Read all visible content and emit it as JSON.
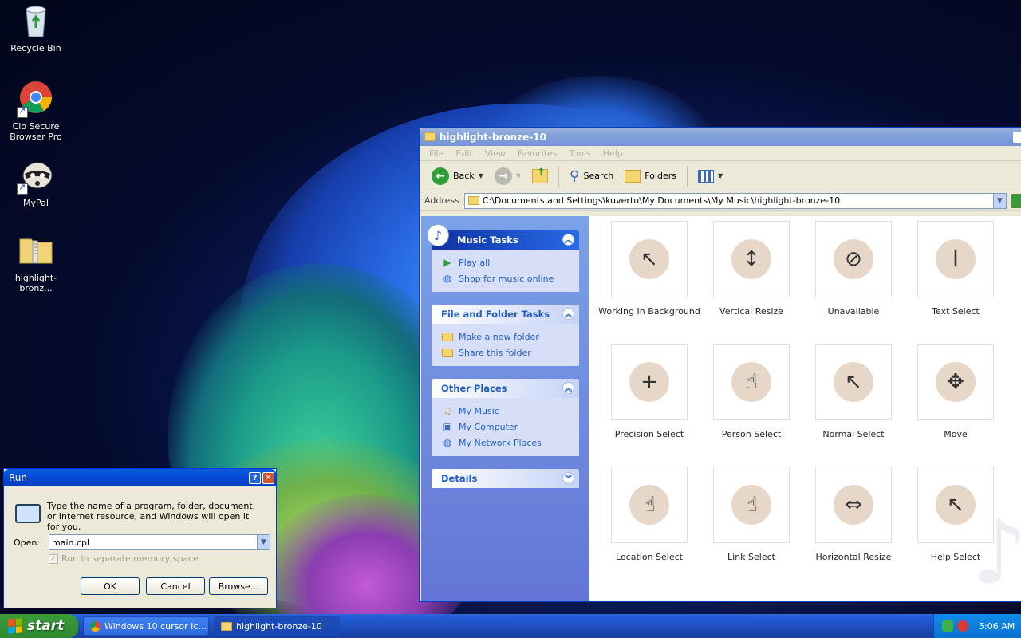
{
  "desktop": {
    "icons": [
      {
        "label": "Recycle Bin"
      },
      {
        "label": "Cio Secure Browser Pro"
      },
      {
        "label": "MyPal"
      },
      {
        "label": "highlight-bronz..."
      }
    ]
  },
  "explorer": {
    "title": "highlight-bronze-10",
    "menu": [
      "File",
      "Edit",
      "View",
      "Favorites",
      "Tools",
      "Help"
    ],
    "toolbar": {
      "back": "Back",
      "search": "Search",
      "folders": "Folders"
    },
    "address": {
      "label": "Address",
      "path": "C:\\Documents and Settings\\kuvertu\\My Documents\\My Music\\highlight-bronze-10"
    },
    "tasks": {
      "music": {
        "title": "Music Tasks",
        "items": [
          "Play all",
          "Shop for music online"
        ]
      },
      "file_folder": {
        "title": "File and Folder Tasks",
        "items": [
          "Make a new folder",
          "Share this folder"
        ]
      },
      "other": {
        "title": "Other Places",
        "items": [
          "My Music",
          "My Computer",
          "My Network Places"
        ]
      },
      "details": {
        "title": "Details"
      }
    },
    "files": [
      {
        "label": "Working In Background",
        "glyph": "↖"
      },
      {
        "label": "Vertical Resize",
        "glyph": "↕"
      },
      {
        "label": "Unavailable",
        "glyph": "⊘"
      },
      {
        "label": "Text Select",
        "glyph": "I"
      },
      {
        "label": "Precision Select",
        "glyph": "+"
      },
      {
        "label": "Person Select",
        "glyph": "☝"
      },
      {
        "label": "Normal Select",
        "glyph": "↖"
      },
      {
        "label": "Move",
        "glyph": "✥"
      },
      {
        "label": "Location Select",
        "glyph": "☝"
      },
      {
        "label": "Link Select",
        "glyph": "☝"
      },
      {
        "label": "Horizontal Resize",
        "glyph": "⇔"
      },
      {
        "label": "Help Select",
        "glyph": "↖"
      }
    ]
  },
  "run": {
    "title": "Run",
    "description": "Type the name of a program, folder, document, or Internet resource, and Windows will open it for you.",
    "open_label": "Open:",
    "open_value": "main.cpl",
    "checkbox_label": "Run in separate memory space",
    "ok": "OK",
    "cancel": "Cancel",
    "browse": "Browse..."
  },
  "taskbar": {
    "start": "start",
    "tasks": [
      "Windows 10 cursor Ic...",
      "highlight-bronze-10"
    ],
    "clock": "5:06 AM"
  }
}
